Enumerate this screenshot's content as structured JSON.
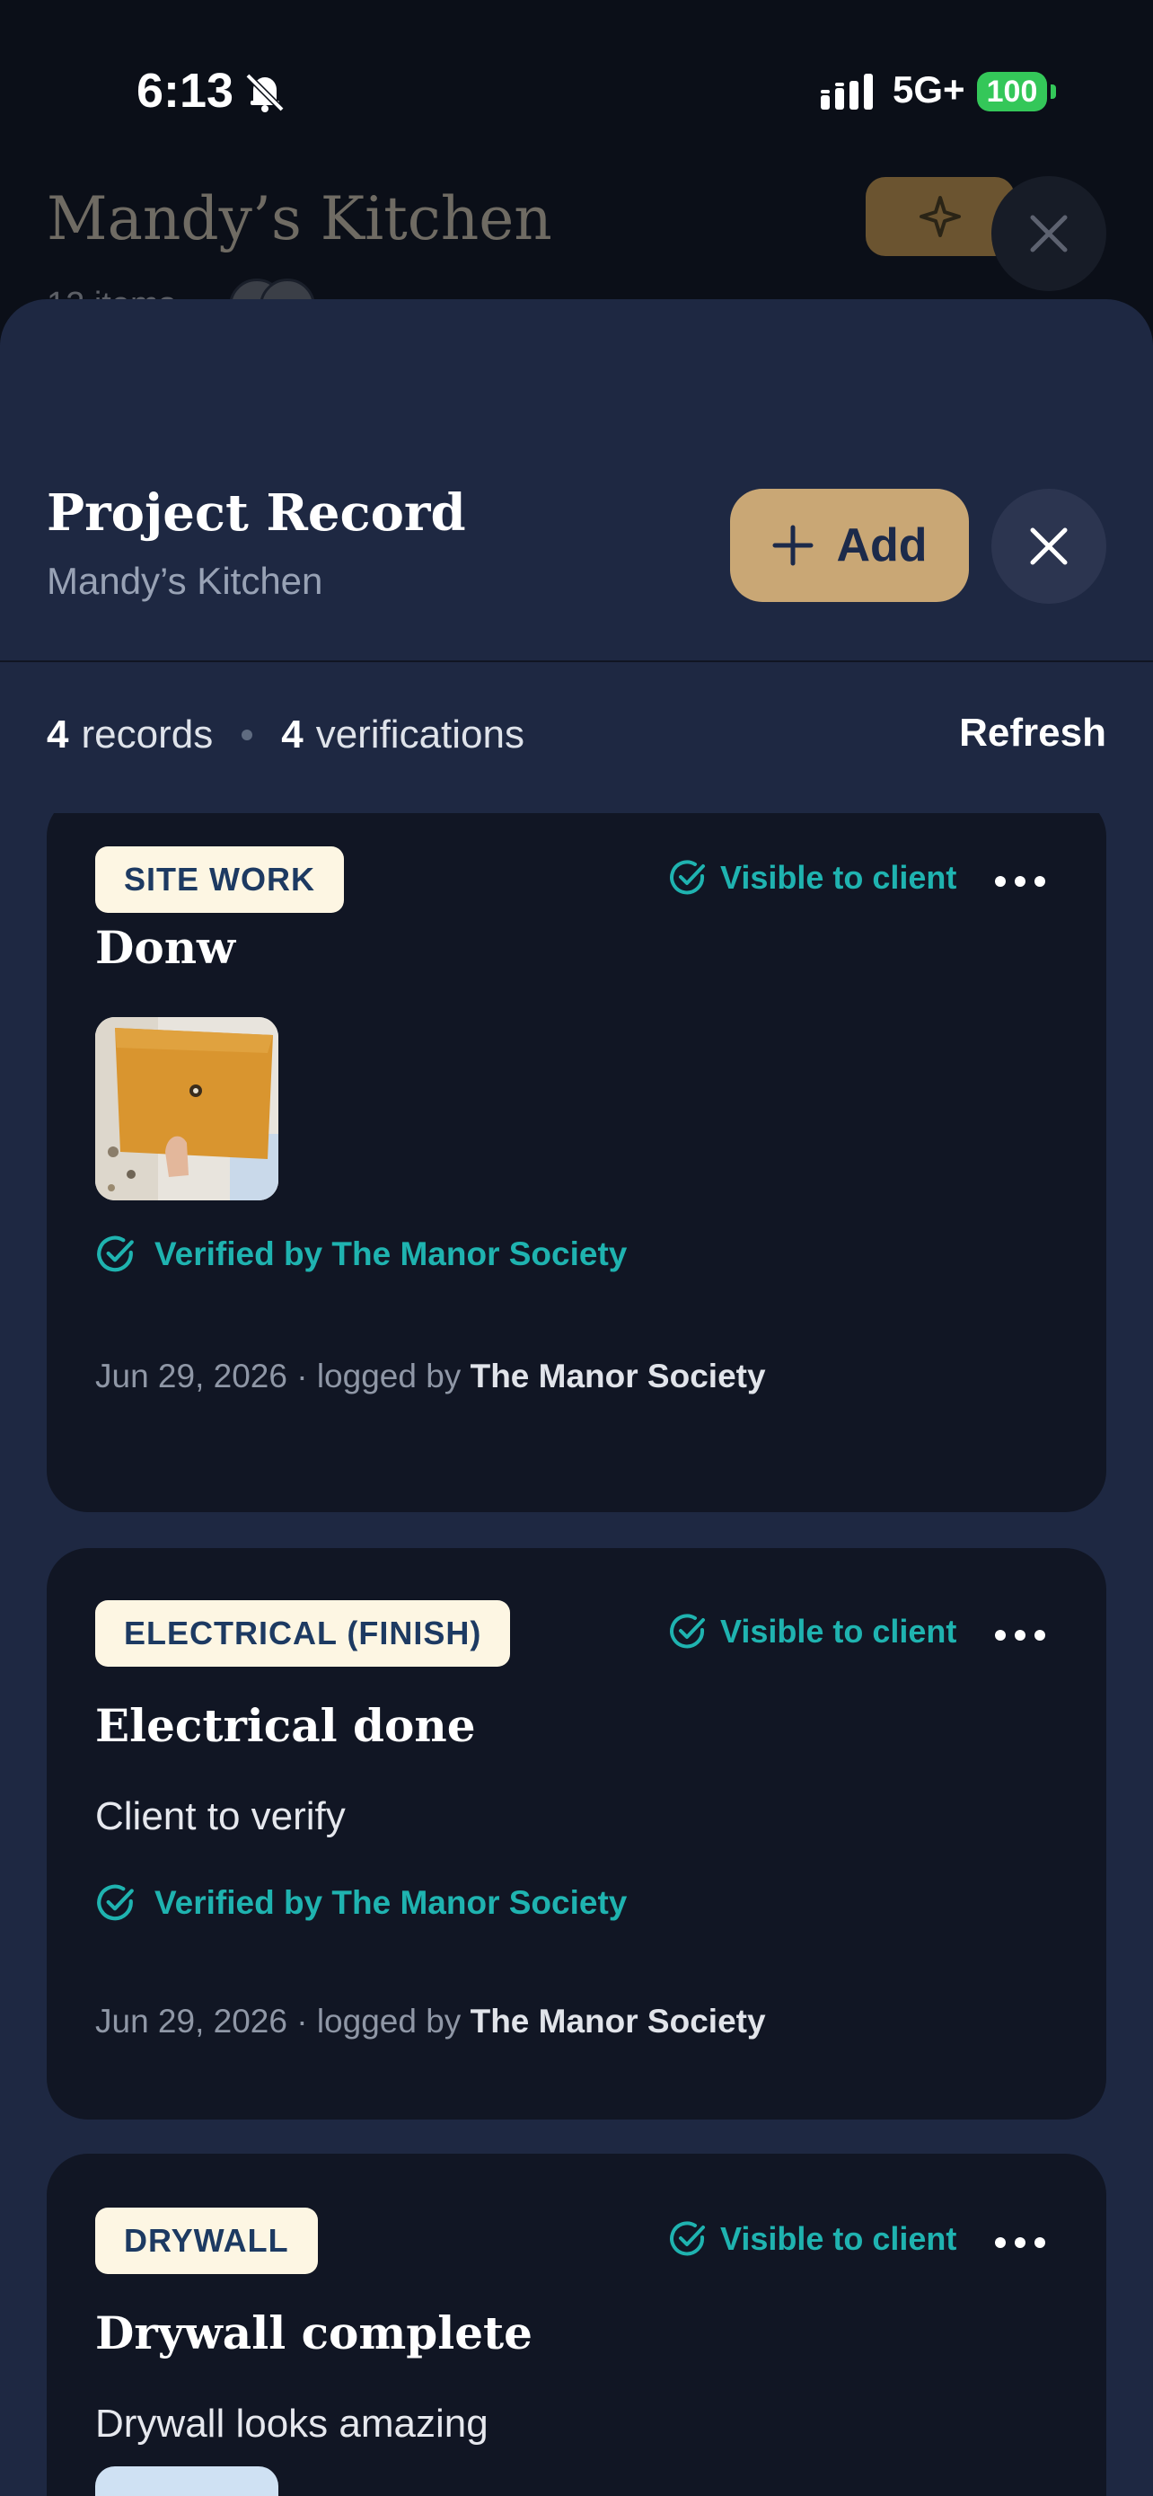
{
  "status_bar": {
    "time": "6:13",
    "network": "5G+",
    "battery": "100",
    "icons": [
      "bell-slash-icon",
      "signal-icon"
    ]
  },
  "background_app": {
    "title": "Mandy’s Kitchen",
    "subtitle": "12 items",
    "icons": [
      "sparkle-icon",
      "close-icon"
    ]
  },
  "sheet": {
    "title": "Project Record",
    "subtitle": "Mandy’s Kitchen",
    "add_label": "Add",
    "icons": [
      "plus-icon",
      "close-icon"
    ]
  },
  "summary": {
    "records_count": "4",
    "records_label": "records",
    "verifications_count": "4",
    "verifications_label": "verifications",
    "refresh_label": "Refresh"
  },
  "records": [
    {
      "tag": "SITE WORK",
      "visibility": "Visible to client",
      "title": "Donw",
      "has_photo": true,
      "verified": "Verified by The Manor Society",
      "date": "Jun 29, 2026 · logged by",
      "logged_by": "The Manor Society"
    },
    {
      "tag": "ELECTRICAL (FINISH)",
      "visibility": "Visible to client",
      "title": "Electrical done",
      "note": "Client to verify",
      "verified": "Verified by The Manor Society",
      "date": "Jun 29, 2026 · logged by",
      "logged_by": "The Manor Society"
    },
    {
      "tag": "DRYWALL",
      "visibility": "Visible to client",
      "title": "Drywall complete",
      "note": "Drywall looks amazing"
    }
  ],
  "colors": {
    "sheet_bg": "#1e2842",
    "card_bg": "#111624",
    "accent_gold": "#c9a775",
    "verified_teal": "#1fb3b0",
    "tag_bg": "#fdf6e3"
  }
}
